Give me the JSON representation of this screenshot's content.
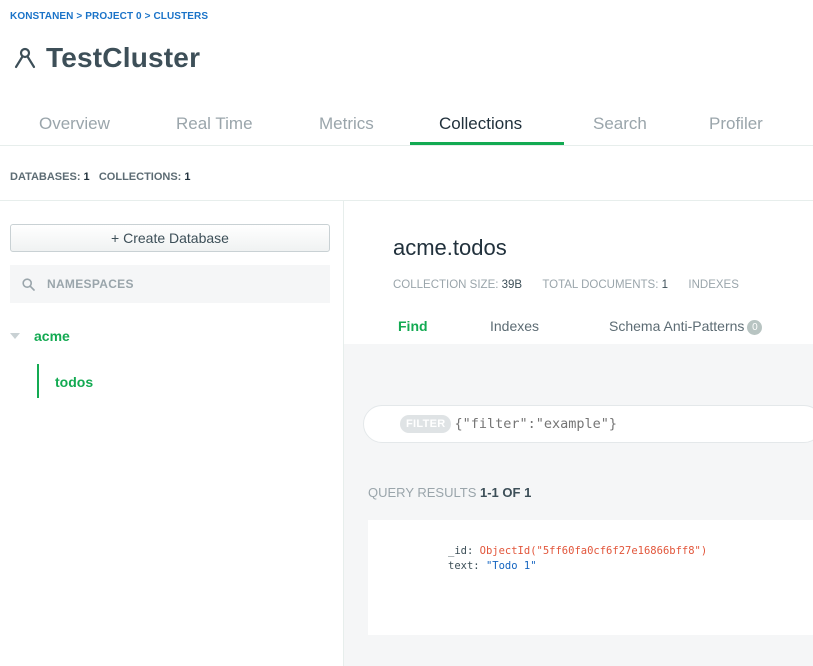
{
  "breadcrumb": {
    "org": "KONSTANEN",
    "sep1": ">",
    "project": "PROJECT 0",
    "sep2": ">",
    "section": "CLUSTERS"
  },
  "cluster": {
    "title": "TestCluster",
    "icon": "cluster-icon"
  },
  "tabs": [
    {
      "label": "Overview",
      "active": false
    },
    {
      "label": "Real Time",
      "active": false
    },
    {
      "label": "Metrics",
      "active": false
    },
    {
      "label": "Collections",
      "active": true
    },
    {
      "label": "Search",
      "active": false
    },
    {
      "label": "Profiler",
      "active": false
    }
  ],
  "counts": {
    "databases_label": "DATABASES:",
    "databases": "1",
    "collections_label": "COLLECTIONS:",
    "collections": "1"
  },
  "sidebar": {
    "create_database_label": "+ Create Database",
    "namespaces_placeholder": "NAMESPACES",
    "databases": [
      {
        "name": "acme",
        "collections": [
          {
            "name": "todos",
            "selected": true
          }
        ]
      }
    ]
  },
  "namespace": {
    "title": "acme.todos",
    "stats": {
      "size_label": "COLLECTION SIZE:",
      "size": "39B",
      "docs_label": "TOTAL DOCUMENTS:",
      "docs": "1",
      "indexes_label": "INDEXES"
    }
  },
  "subtabs": [
    {
      "label": "Find",
      "active": true
    },
    {
      "label": "Indexes",
      "active": false
    },
    {
      "label": "Schema Anti-Patterns",
      "badge": "0",
      "active": false
    }
  ],
  "filter": {
    "badge": "FILTER",
    "placeholder": "{\"filter\":\"example\"}"
  },
  "results": {
    "label": "QUERY RESULTS",
    "range": "1-1 OF 1"
  },
  "document": {
    "fields": [
      {
        "key": "_id:",
        "value": "ObjectId(\"5ff60fa0cf6f27e16866bff8\")",
        "type": "oid"
      },
      {
        "key": "text:",
        "value": "\"Todo 1\"",
        "type": "str"
      }
    ]
  },
  "colors": {
    "accent": "#13aa52",
    "link": "#016bf8",
    "oid": "#e2563b",
    "string": "#1565c0"
  }
}
